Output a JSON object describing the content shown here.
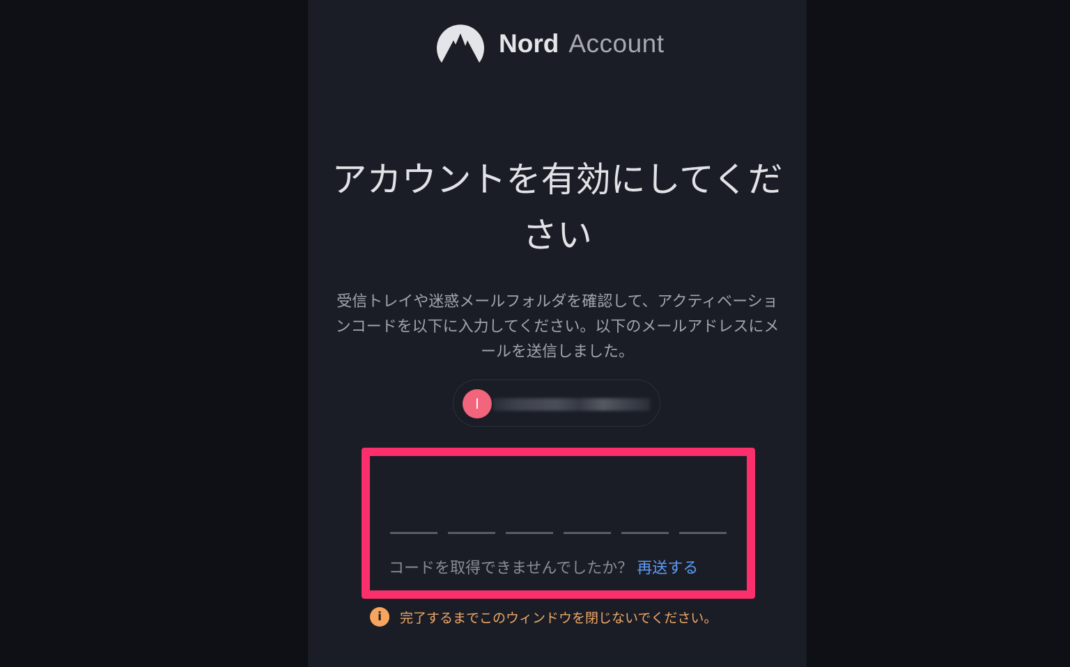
{
  "brand": {
    "name": "Nord",
    "product": "Account",
    "logo_icon": "nord-mountain-logo"
  },
  "title": "アカウントを有効にしてください",
  "description": "受信トレイや迷惑メールフォルダを確認して、アクティベーションコードを以下に入力してください。以下のメールアドレスにメールを送信しました。",
  "account": {
    "avatar_initial": "I",
    "email": "(blurred)"
  },
  "code_input": {
    "slots": 6,
    "values": [
      "",
      "",
      "",
      "",
      "",
      ""
    ]
  },
  "resend": {
    "prompt": "コードを取得できませんでしたか？",
    "link_label": "再送する"
  },
  "warning": {
    "icon": "info-icon",
    "text": "完了するまでこのウィンドウを閉じないでください。"
  },
  "colors": {
    "highlight": "#fb2f6c",
    "link": "#5f9bf5",
    "warning": "#f0a868",
    "avatar": "#f2657d"
  }
}
